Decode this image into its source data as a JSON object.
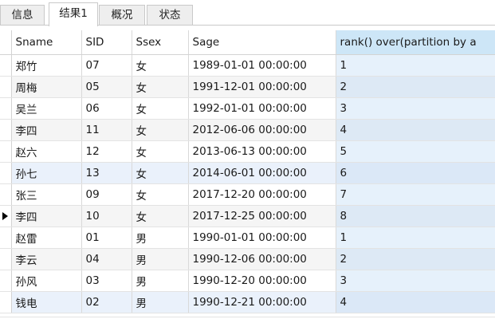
{
  "tabs": [
    {
      "label": "信息",
      "active": false
    },
    {
      "label": "结果1",
      "active": true
    },
    {
      "label": "概况",
      "active": false
    },
    {
      "label": "状态",
      "active": false
    }
  ],
  "grid": {
    "columns": [
      "Sname",
      "SID",
      "Ssex",
      "Sage",
      "rank() over(partition by a"
    ],
    "rows": [
      {
        "Sname": "郑竹",
        "SID": "07",
        "Ssex": "女",
        "Sage": "1989-01-01 00:00:00",
        "rank": "1"
      },
      {
        "Sname": "周梅",
        "SID": "05",
        "Ssex": "女",
        "Sage": "1991-12-01 00:00:00",
        "rank": "2"
      },
      {
        "Sname": "吴兰",
        "SID": "06",
        "Ssex": "女",
        "Sage": "1992-01-01 00:00:00",
        "rank": "3"
      },
      {
        "Sname": "李四",
        "SID": "11",
        "Ssex": "女",
        "Sage": "2012-06-06 00:00:00",
        "rank": "4"
      },
      {
        "Sname": "赵六",
        "SID": "12",
        "Ssex": "女",
        "Sage": "2013-06-13 00:00:00",
        "rank": "5"
      },
      {
        "Sname": "孙七",
        "SID": "13",
        "Ssex": "女",
        "Sage": "2014-06-01 00:00:00",
        "rank": "6"
      },
      {
        "Sname": "张三",
        "SID": "09",
        "Ssex": "女",
        "Sage": "2017-12-20 00:00:00",
        "rank": "7"
      },
      {
        "Sname": "李四",
        "SID": "10",
        "Ssex": "女",
        "Sage": "2017-12-25 00:00:00",
        "rank": "8"
      },
      {
        "Sname": "赵雷",
        "SID": "01",
        "Ssex": "男",
        "Sage": "1990-01-01 00:00:00",
        "rank": "1"
      },
      {
        "Sname": "李云",
        "SID": "04",
        "Ssex": "男",
        "Sage": "1990-12-06 00:00:00",
        "rank": "2"
      },
      {
        "Sname": "孙风",
        "SID": "03",
        "Ssex": "男",
        "Sage": "1990-12-20 00:00:00",
        "rank": "3"
      },
      {
        "Sname": "钱电",
        "SID": "02",
        "Ssex": "男",
        "Sage": "1990-12-21 00:00:00",
        "rank": "4"
      }
    ],
    "current_row_index": 7,
    "highlighted_rows": [
      5,
      11
    ],
    "selected_column": 4
  },
  "colors": {
    "selected_header": "#cde6f7",
    "selected_column_cells": "#e6f1fb",
    "highlighted_row": "#eaf1fb",
    "alternate_row": "#f5f5f5",
    "grid_line": "#d9d9d9"
  }
}
